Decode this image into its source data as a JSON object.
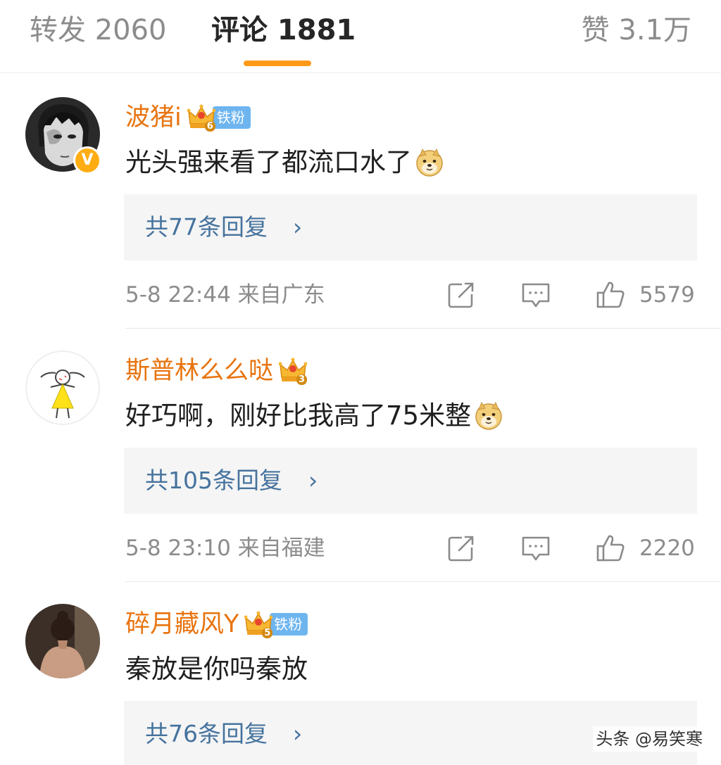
{
  "tabs": {
    "repost": "转发 2060",
    "comments": "评论 1881",
    "likes": "赞 3.1万"
  },
  "colors": {
    "accent": "#ff9a19",
    "username": "#e8740f",
    "reply_link": "#46739e",
    "fan_badge": "#6eb5ef"
  },
  "comments": [
    {
      "username": "波猪i",
      "crown_level": "6",
      "fan_badge": "铁粉",
      "verified": "V",
      "text": "光头强来看了都流口水了",
      "emoji": "doge-icon",
      "replies": "共77条回复",
      "chevron": "›",
      "timestamp": "5-8 22:44  来自广东",
      "likes": "5579"
    },
    {
      "username": "斯普林么么哒",
      "crown_level": "3",
      "text": "好巧啊，刚好比我高了75米整",
      "emoji": "doge-icon",
      "replies": "共105条回复",
      "chevron": "›",
      "timestamp": "5-8 23:10  来自福建",
      "likes": "2220"
    },
    {
      "username": "碎月藏风Y",
      "crown_level": "5",
      "fan_badge": "铁粉",
      "text": "秦放是你吗秦放",
      "replies": "共76条回复",
      "chevron": "›"
    }
  ],
  "watermark": "头条 @易笑寒"
}
